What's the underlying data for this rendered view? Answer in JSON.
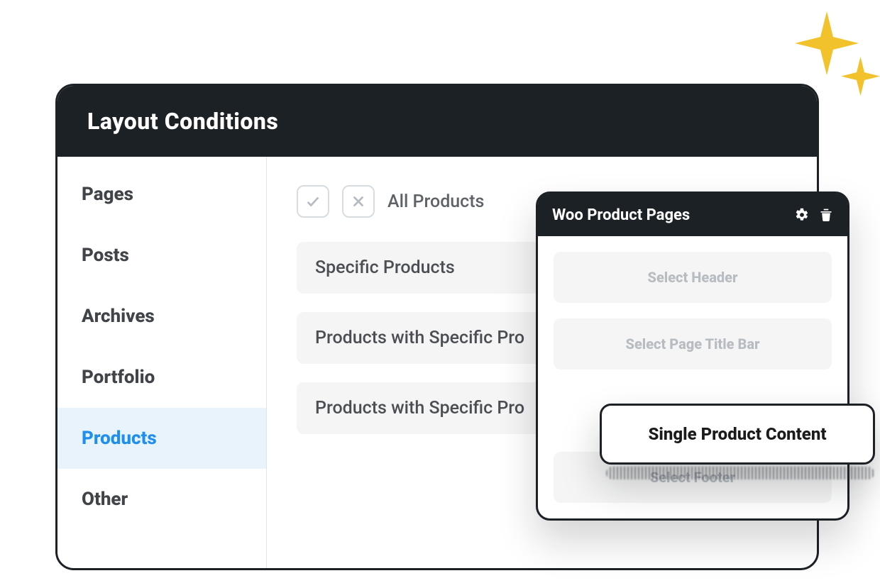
{
  "panel": {
    "title": "Layout Conditions",
    "all_label": "All Products"
  },
  "sidebar": {
    "items": [
      {
        "label": "Pages",
        "active": false
      },
      {
        "label": "Posts",
        "active": false
      },
      {
        "label": "Archives",
        "active": false
      },
      {
        "label": "Portfolio",
        "active": false
      },
      {
        "label": "Products",
        "active": true
      },
      {
        "label": "Other",
        "active": false
      }
    ]
  },
  "options": [
    {
      "label": "Specific Products"
    },
    {
      "label": "Products with Specific Pro"
    },
    {
      "label": "Products with Specific Pro"
    }
  ],
  "card": {
    "title": "Woo Product Pages",
    "slots": [
      {
        "label": "Select Header"
      },
      {
        "label": "Select Page Title Bar"
      },
      {
        "label": "Select Footer"
      }
    ]
  },
  "callout": {
    "label": "Single Product Content"
  }
}
